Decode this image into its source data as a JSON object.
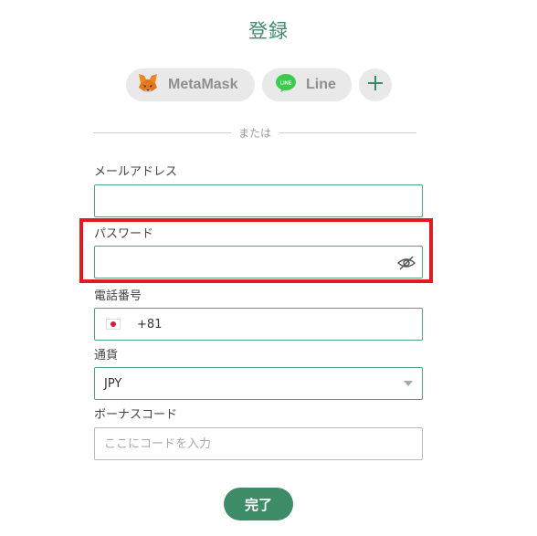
{
  "page_title": "登録",
  "social": {
    "metamask_label": "MetaMask",
    "line_label": "Line",
    "line_badge": "LINE",
    "more_icon": "plus-icon"
  },
  "divider_text": "または",
  "form": {
    "email": {
      "label": "メールアドレス",
      "value": ""
    },
    "password": {
      "label": "パスワード",
      "value": "",
      "toggle_icon": "eye-slash-icon"
    },
    "phone": {
      "label": "電話番号",
      "country_flag": "jp-flag-icon",
      "dial_code": "+81"
    },
    "currency": {
      "label": "通貨",
      "selected": "JPY"
    },
    "bonus_code": {
      "label": "ボーナスコード",
      "placeholder": "ここにコードを入力"
    }
  },
  "submit_label": "完了",
  "colors": {
    "accent": "#3e8b67",
    "border": "#4ea27e",
    "highlight": "#e01b24"
  }
}
